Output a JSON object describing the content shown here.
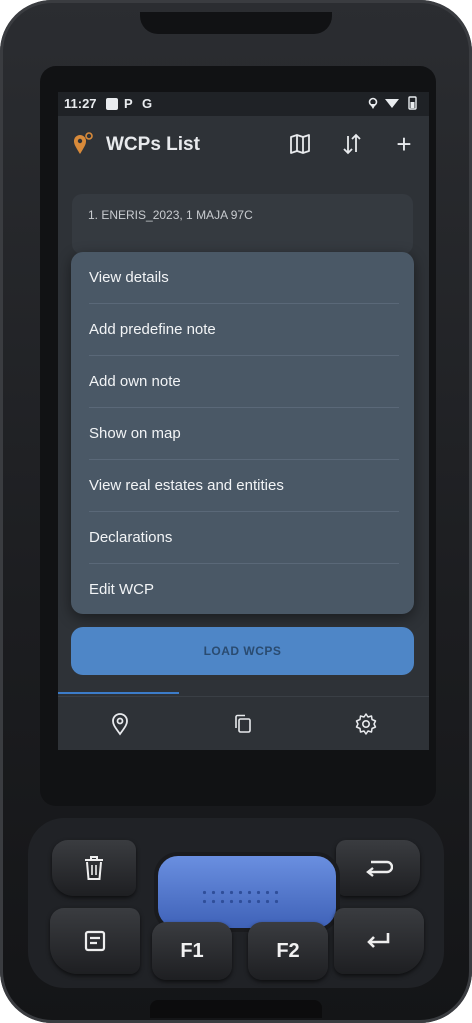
{
  "status_bar": {
    "time": "11:27",
    "p_indicator": "P",
    "g_indicator": "G",
    "right_icons": "⚲ ▾ ▮"
  },
  "app_bar": {
    "title": "WCPs List",
    "actions": [
      {
        "icon": "map-icon"
      },
      {
        "icon": "sort-icon"
      },
      {
        "icon": "add-icon",
        "glyph": "+"
      }
    ]
  },
  "list": {
    "items": [
      {
        "label": "1. ENERIS_2023, 1 MAJA 97C"
      }
    ]
  },
  "context_menu": {
    "items": [
      {
        "label": "View details"
      },
      {
        "label": "Add predefine note"
      },
      {
        "label": "Add own note"
      },
      {
        "label": "Show on map"
      },
      {
        "label": "View real estates and entities"
      },
      {
        "label": "Declarations"
      },
      {
        "label": "Edit WCP"
      }
    ]
  },
  "load_button": {
    "label": "LOAD WCPS"
  },
  "bottom_nav": {
    "tabs": [
      {
        "icon": "location-pin-icon",
        "selected": true
      },
      {
        "icon": "copy-documents-icon",
        "selected": false
      },
      {
        "icon": "settings-gear-icon",
        "selected": false
      }
    ]
  },
  "hardware_keys": {
    "f1": "F1",
    "f2": "F2"
  },
  "colors": {
    "screen_bg": "#2e3237",
    "menu_bg": "#4a5866",
    "accent": "#4e86c7",
    "logo_orange": "#d88a3a"
  }
}
